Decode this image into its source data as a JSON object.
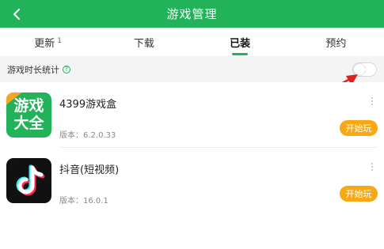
{
  "header": {
    "title": "游戏管理",
    "back_icon": "back-chevron-icon",
    "background": "#22b35a"
  },
  "tabs": [
    {
      "label": "更新",
      "badge": "1",
      "active": false
    },
    {
      "label": "下载",
      "active": false
    },
    {
      "label": "已装",
      "active": true
    },
    {
      "label": "预约",
      "active": false
    }
  ],
  "stats": {
    "label": "游戏时长统计",
    "help_icon": "?",
    "toggle_on": false
  },
  "apps": [
    {
      "name": "4399游戏盒",
      "version": "版本：6.2.0.33",
      "icon_text_line1": "游戏",
      "icon_text_line2": "大全",
      "action": "开始玩"
    },
    {
      "name": "抖音(短视频)",
      "version": "版本：16.0.1",
      "action": "开始玩"
    }
  ],
  "colors": {
    "accent": "#22b35a",
    "play_button": "#f8a813",
    "annotation_arrow": "#e02020"
  }
}
